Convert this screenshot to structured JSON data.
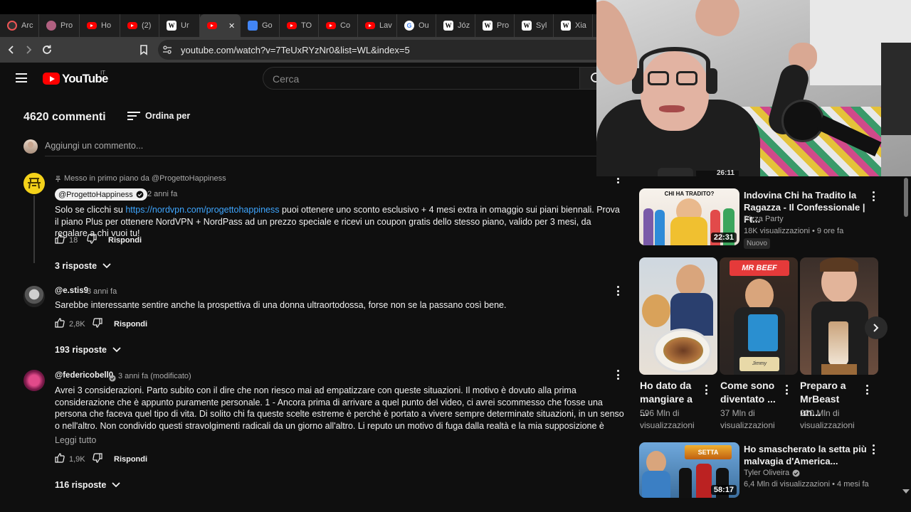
{
  "browser": {
    "tabs": [
      {
        "label": "Arc",
        "icon": "circle-favicon"
      },
      {
        "label": "Pro",
        "icon": "avatar-favicon"
      },
      {
        "label": "Ho",
        "icon": "youtube-favicon"
      },
      {
        "label": "(2)",
        "icon": "youtube-favicon"
      },
      {
        "label": "Ur",
        "icon": "wikipedia-favicon"
      },
      {
        "label": "",
        "icon": "youtube-favicon"
      },
      {
        "label": "Go",
        "icon": "docs-favicon"
      },
      {
        "label": "TO",
        "icon": "youtube-favicon"
      },
      {
        "label": "Co",
        "icon": "youtube-favicon"
      },
      {
        "label": "Lav",
        "icon": "youtube-favicon"
      },
      {
        "label": "Ou",
        "icon": "google-favicon"
      },
      {
        "label": "Józ",
        "icon": "wikipedia-favicon"
      },
      {
        "label": "Pro",
        "icon": "wikipedia-favicon"
      },
      {
        "label": "Syl",
        "icon": "wikipedia-favicon"
      },
      {
        "label": "Xia",
        "icon": "wikipedia-favicon"
      }
    ],
    "close_glyph": "✕",
    "url": "youtube.com/watch?v=7TeUxRYzNr0&list=WL&index=5"
  },
  "youtube": {
    "logo_text": "YouTube",
    "region": "IT",
    "search_placeholder": "Cerca"
  },
  "comments_header": {
    "count": "4620 commenti",
    "sort_label": "Ordina per",
    "add_placeholder": "Aggiungi un commento..."
  },
  "comments": [
    {
      "pinned": "Messo in primo piano da @ProgettoHappiness",
      "handle": "@ProgettoHappiness",
      "time": "2 anni fa",
      "text_pre": "Solo se clicchi su ",
      "link": "https://nordvpn.com/progettohappiness",
      "text_post": " puoi ottenere uno sconto esclusivo + 4 mesi extra in omaggio sui piani biennali. Prova il piano Plus per ottenere NordVPN + NordPass ad un prezzo speciale e ricevi un coupon gratis dello stesso piano, valido per 3 mesi, da regalare a chi vuoi tu!",
      "likes": "18",
      "reply_label": "Rispondi",
      "replies": "3 risposte"
    },
    {
      "handle": "@e.stis9",
      "time": "3 anni fa",
      "text": "Sarebbe interessante sentire anche la prospettiva di una donna ultraortodossa, forse non se la passano così bene.",
      "likes": "2,8K",
      "reply_label": "Rispondi",
      "replies": "193 risposte"
    },
    {
      "handle": "@federicobell0",
      "time": "3 anni fa (modificato)",
      "text": "Avrei 3 considerazioni. Parto subito con il dire che non riesco mai ad empatizzare con queste situazioni. Il motivo è dovuto alla prima considerazione che è appunto puramente personale. 1 - Ancora prima di arrivare a quel punto del video, ci avrei scommesso che fosse una persona che faceva quel tipo di vita. Di solito chi fa queste scelte estreme è perchè è portato a vivere sempre determinate situazioni, in un senso o nell'altro. Non condivido questi stravolgimenti radicali da un giorno all'altro. Li reputo un motivo di fuga dalla realtà e la mia supposizione è supportata dal fatto che non può neanche accedere ad internet...",
      "read_more": "Leggi tutto",
      "likes": "1,9K",
      "reply_label": "Rispondi",
      "replies": "116 risposte"
    }
  ],
  "sidebar": {
    "partial_duration": "26:11",
    "video1": {
      "thumb_caption": "CHI HA TRADITO?",
      "duration": "22:31",
      "title": "Indovina Chi ha Tradito la Ragazza - Il Confessionale | Ft...",
      "channel": "Pizza Party",
      "views": "18K visualizzazioni",
      "age": "9 ore fa",
      "badge": "Nuovo"
    },
    "shorts": [
      {
        "title": "Ho dato da mangiare a ...",
        "views": "596 Mln di visualizzazioni"
      },
      {
        "title": "Come sono diventato ...",
        "views": "37 Mln di visualizzazioni",
        "sign": "MR BEEF",
        "bag": "Jimmy"
      },
      {
        "title": "Preparo a MrBeast un...",
        "views": "220 Mln di visualizzazioni"
      }
    ],
    "video2": {
      "thumb_caption": "SETTA",
      "duration": "58:17",
      "title": "Ho smascherato la setta più malvagia d'America...",
      "channel": "Tyler Oliveira",
      "views": "6,4 Mln di visualizzazioni",
      "age": "4 mesi fa"
    }
  },
  "colors": {
    "background": "#0f0f0f",
    "link": "#3ea6ff",
    "youtube_red": "#ff0000",
    "muted_text": "#aaaaaa"
  }
}
